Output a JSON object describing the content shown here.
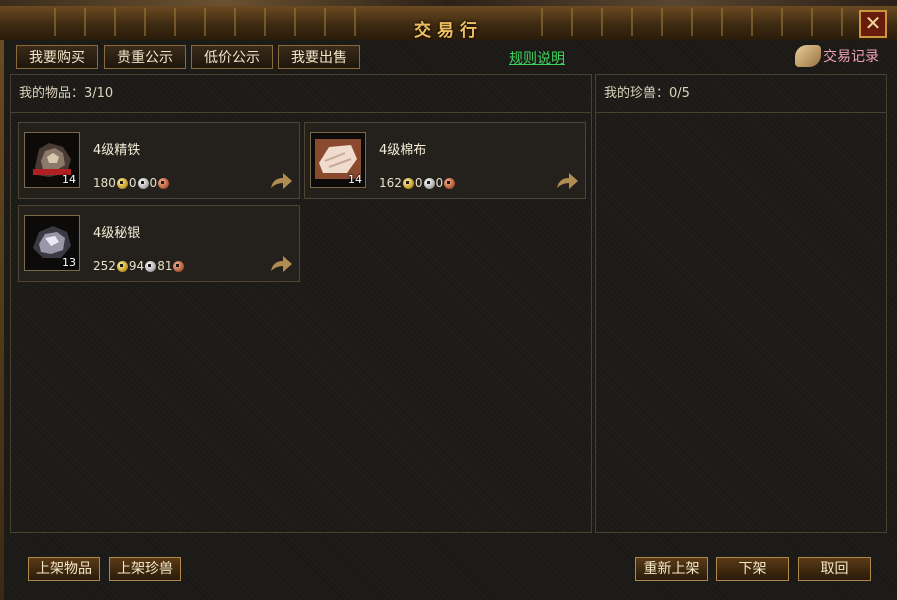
{
  "window": {
    "title": "交易行",
    "close_symbol": "✕"
  },
  "tabs": [
    {
      "label": "我要购买"
    },
    {
      "label": "贵重公示"
    },
    {
      "label": "低价公示"
    },
    {
      "label": "我要出售"
    }
  ],
  "rules_link": "规则说明",
  "trade_record": "交易记录",
  "items_panel": {
    "header": "我的物品：3/10",
    "items": [
      {
        "name": "4级精铁",
        "quantity": "14",
        "gold": "180",
        "silver": "0",
        "copper": "0",
        "icon": "iron-ore-icon"
      },
      {
        "name": "4级棉布",
        "quantity": "14",
        "gold": "162",
        "silver": "0",
        "copper": "0",
        "icon": "cotton-cloth-icon"
      },
      {
        "name": "4级秘银",
        "quantity": "13",
        "gold": "252",
        "silver": "94",
        "copper": "81",
        "icon": "mithril-ore-icon"
      }
    ]
  },
  "pets_panel": {
    "header": "我的珍兽：0/5"
  },
  "bottom_buttons": {
    "list_item": "上架物品",
    "list_pet": "上架珍兽",
    "relist": "重新上架",
    "delist": "下架",
    "cancel": "取回"
  },
  "colors": {
    "accent_gold": "#f0c060",
    "link_green": "#3dd25a",
    "record_pink": "#f0a0b8"
  }
}
